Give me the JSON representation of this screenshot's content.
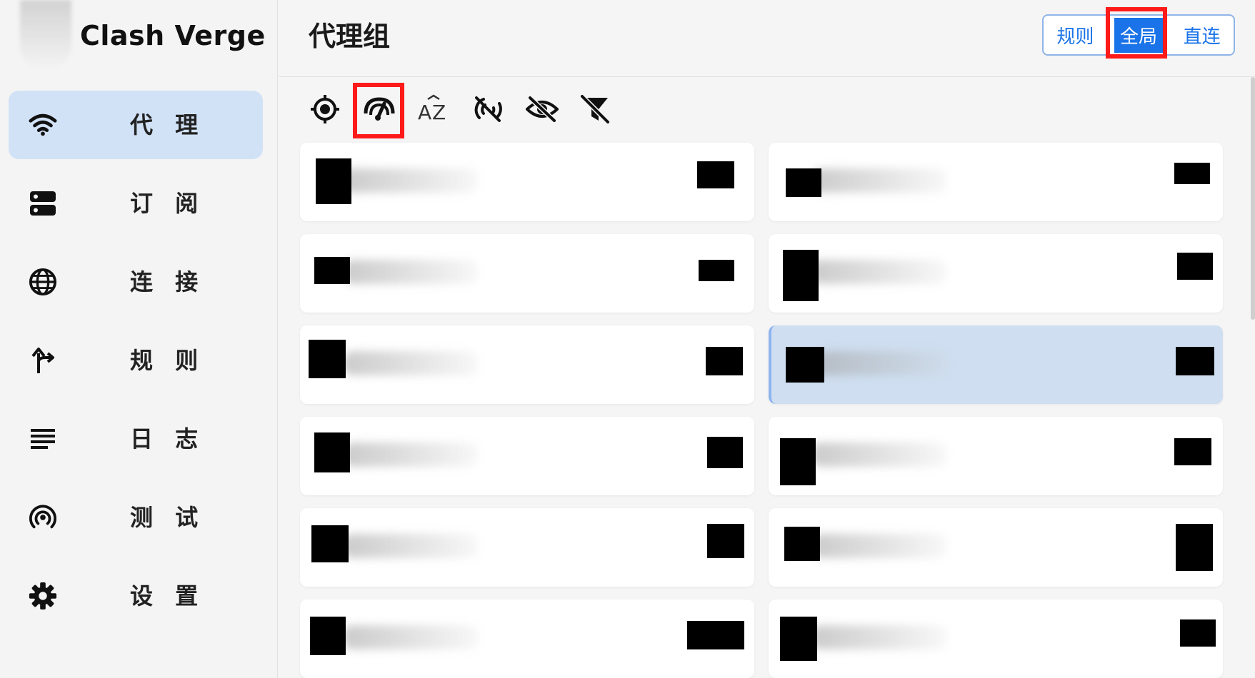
{
  "app": {
    "title": "Clash Verge"
  },
  "sidebar": {
    "items": [
      {
        "label": "代 理",
        "icon": "wifi-icon",
        "active": true
      },
      {
        "label": "订 阅",
        "icon": "server-icon",
        "active": false
      },
      {
        "label": "连 接",
        "icon": "globe-icon",
        "active": false
      },
      {
        "label": "规 则",
        "icon": "route-arrow-icon",
        "active": false
      },
      {
        "label": "日 志",
        "icon": "lines-icon",
        "active": false
      },
      {
        "label": "测 试",
        "icon": "broadcast-icon",
        "active": false
      },
      {
        "label": "设 置",
        "icon": "gear-icon",
        "active": false
      }
    ]
  },
  "header": {
    "title": "代理组",
    "modes": [
      {
        "label": "规则",
        "active": false
      },
      {
        "label": "全局",
        "active": true
      },
      {
        "label": "直连",
        "active": false
      }
    ]
  },
  "toolbar": {
    "icons": [
      "locate-icon",
      "speed-test-icon",
      "sort-az-icon",
      "signal-off-icon",
      "eye-off-icon",
      "filter-off-icon"
    ]
  },
  "proxies": {
    "cards": [
      {
        "selected": false
      },
      {
        "selected": false
      },
      {
        "selected": false
      },
      {
        "selected": false
      },
      {
        "selected": false
      },
      {
        "selected": true
      },
      {
        "selected": false
      },
      {
        "selected": false
      },
      {
        "selected": false
      },
      {
        "selected": false
      },
      {
        "selected": false
      },
      {
        "selected": false
      }
    ]
  },
  "colors": {
    "accent": "#1a73e8",
    "active_nav_bg": "#d2e2f6",
    "selected_card_bg": "#cfdff1",
    "highlight": "#ff1a1a"
  }
}
